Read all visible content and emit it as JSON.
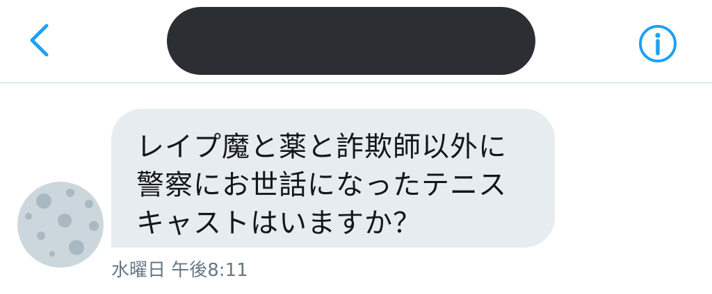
{
  "header": {
    "back_icon": "chevron-left-icon",
    "title_redacted": true,
    "info_icon": "info-circle-icon",
    "accent_color": "#1da1f2"
  },
  "conversation": {
    "messages": [
      {
        "text": "レイプ魔と薬と詐欺師以外に警察にお世話になったテニスキャストはいますか？",
        "timestamp": "水曜日 午後8:11",
        "avatar_icon": "moon-avatar-icon"
      }
    ]
  }
}
